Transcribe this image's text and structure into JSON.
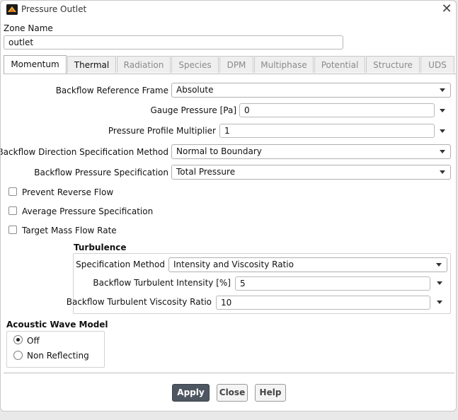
{
  "window": {
    "title": "Pressure Outlet",
    "close_symbol": "✕"
  },
  "zone": {
    "label": "Zone Name",
    "value": "outlet"
  },
  "tabs": [
    {
      "label": "Momentum"
    },
    {
      "label": "Thermal"
    },
    {
      "label": "Radiation"
    },
    {
      "label": "Species"
    },
    {
      "label": "DPM"
    },
    {
      "label": "Multiphase"
    },
    {
      "label": "Potential"
    },
    {
      "label": "Structure"
    },
    {
      "label": "UDS"
    }
  ],
  "momentum": {
    "backflow_reference_frame": {
      "label": "Backflow Reference Frame",
      "value": "Absolute"
    },
    "gauge_pressure": {
      "label": "Gauge Pressure [Pa]",
      "value": "0"
    },
    "pressure_profile_multiplier": {
      "label": "Pressure Profile Multiplier",
      "value": "1"
    },
    "backflow_direction_method": {
      "label": "Backflow Direction Specification Method",
      "value": "Normal to Boundary"
    },
    "backflow_pressure_spec": {
      "label": "Backflow Pressure Specification",
      "value": "Total Pressure"
    },
    "checkboxes": [
      {
        "label": "Prevent Reverse Flow",
        "checked": false
      },
      {
        "label": "Average Pressure Specification",
        "checked": false
      },
      {
        "label": "Target Mass Flow Rate",
        "checked": false
      }
    ],
    "turbulence": {
      "title": "Turbulence",
      "specification_method": {
        "label": "Specification Method",
        "value": "Intensity and Viscosity Ratio"
      },
      "intensity": {
        "label": "Backflow Turbulent Intensity [%]",
        "value": "5"
      },
      "viscosity_ratio": {
        "label": "Backflow Turbulent Viscosity Ratio",
        "value": "10"
      }
    },
    "acoustic": {
      "title": "Acoustic Wave Model",
      "options": [
        {
          "label": "Off",
          "selected": true
        },
        {
          "label": "Non Reflecting",
          "selected": false
        }
      ]
    }
  },
  "buttons": {
    "apply": "Apply",
    "close": "Close",
    "help": "Help"
  },
  "colors": {
    "primary_button": "#4d5661",
    "accent_edge": "#2fa84f"
  }
}
